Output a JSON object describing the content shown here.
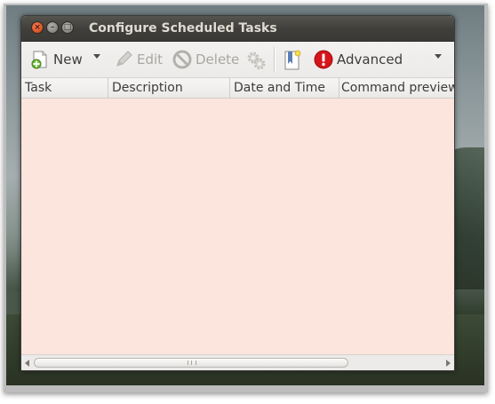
{
  "window": {
    "title": "Configure Scheduled Tasks",
    "controls": [
      "close-icon",
      "minimize-icon",
      "maximize-icon"
    ]
  },
  "toolbar": {
    "new_label": "New",
    "edit_label": "Edit",
    "delete_label": "Delete",
    "advanced_label": "Advanced",
    "icons": {
      "new": "new-document-icon",
      "edit": "pencil-icon",
      "delete": "no-entry-icon",
      "run": "gears-icon",
      "templates": "bookmark-icon",
      "advanced": "warning-icon"
    }
  },
  "table": {
    "columns": [
      "Task",
      "Description",
      "Date and Time",
      "Command preview"
    ],
    "rows": []
  },
  "colors": {
    "list_background": "#fce5dd",
    "titlebar": "#3f3e3a",
    "title_text": "#dfdbd2",
    "close_button": "#e05a2a",
    "advanced_icon": "#d6141a"
  }
}
